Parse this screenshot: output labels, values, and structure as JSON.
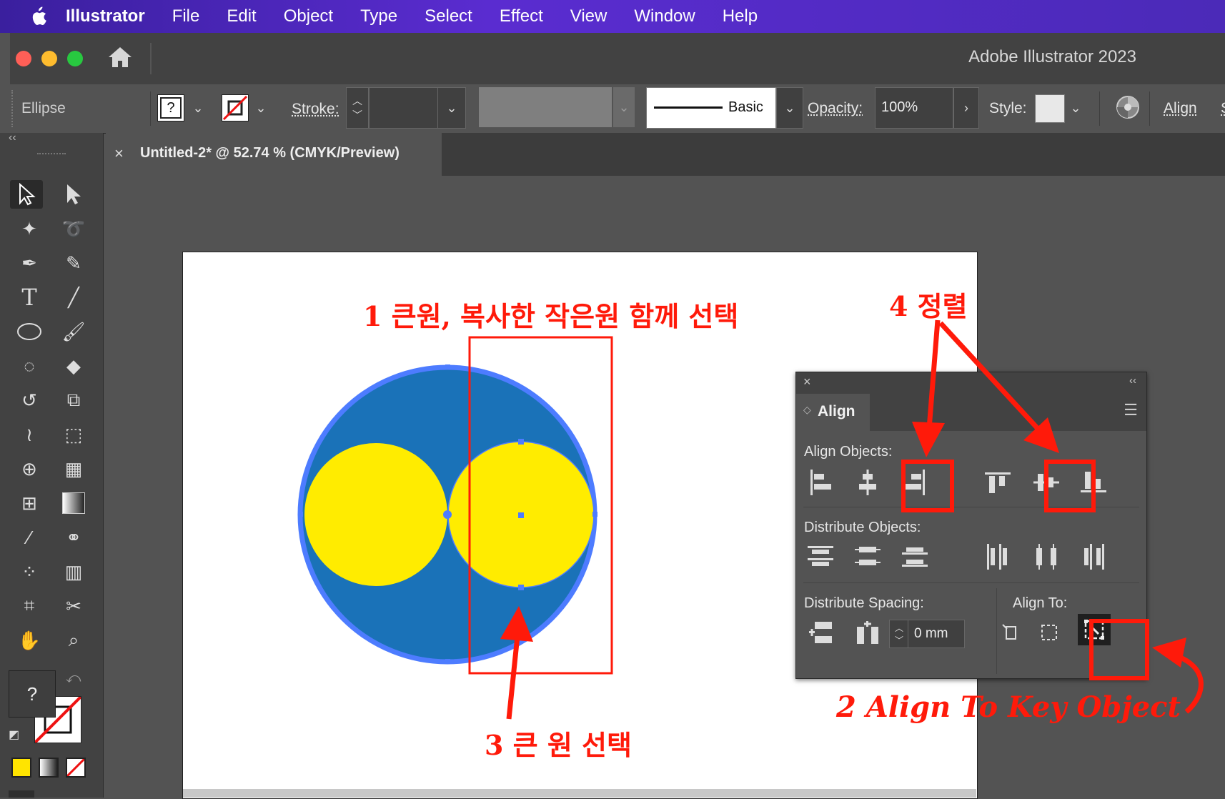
{
  "menubar": {
    "apple_icon": "apple-icon",
    "items": [
      "Illustrator",
      "File",
      "Edit",
      "Object",
      "Type",
      "Select",
      "Effect",
      "View",
      "Window",
      "Help"
    ]
  },
  "window": {
    "title": "Adobe Illustrator 2023"
  },
  "control_bar": {
    "object_type": "Ellipse",
    "fill_indicator": "?",
    "stroke_label": "Stroke:",
    "brush_label": "Basic",
    "opacity_label": "Opacity:",
    "opacity_value": "100%",
    "style_label": "Style:",
    "align_link": "Align"
  },
  "document_tab": {
    "title": "Untitled-2* @ 52.74 % (CMYK/Preview)"
  },
  "toolbar": {
    "fill_indicator": "?"
  },
  "annotations": {
    "step1": "1 큰원, 복사한 작은원 함께 선택",
    "step2": "2 Align To Key Object",
    "step3": "3 큰 원 선택",
    "step4": "4 정렬"
  },
  "align_panel": {
    "title": "Align",
    "align_objects_label": "Align Objects:",
    "distribute_objects_label": "Distribute Objects:",
    "distribute_spacing_label": "Distribute Spacing:",
    "align_to_label": "Align To:",
    "spacing_value": "0 mm"
  },
  "colors": {
    "big_circle_fill": "#1a72b8",
    "big_circle_stroke": "#4d7cff",
    "small_circle_fill": "#ffec00",
    "annotation_red": "#ff1a0a",
    "menubar_purple": "#4b2ab8"
  }
}
